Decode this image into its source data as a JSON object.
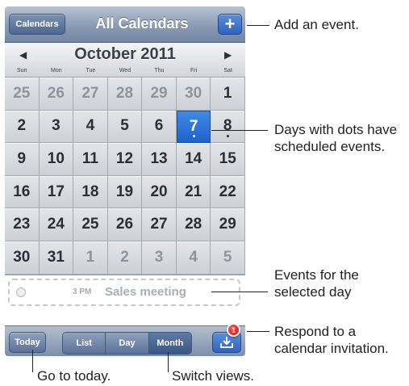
{
  "navbar": {
    "calendars_label": "Calendars",
    "title": "All Calendars",
    "add_label": "+"
  },
  "month": {
    "title": "October 2011",
    "prev_label": "◀",
    "next_label": "▶"
  },
  "weekdays": [
    "Sun",
    "Mon",
    "Tue",
    "Wed",
    "Thu",
    "Fri",
    "Sat"
  ],
  "days": [
    {
      "d": "25",
      "dim": true
    },
    {
      "d": "26",
      "dim": true
    },
    {
      "d": "27",
      "dim": true
    },
    {
      "d": "28",
      "dim": true
    },
    {
      "d": "29",
      "dim": true
    },
    {
      "d": "30",
      "dim": true
    },
    {
      "d": "1"
    },
    {
      "d": "2"
    },
    {
      "d": "3"
    },
    {
      "d": "4"
    },
    {
      "d": "5"
    },
    {
      "d": "6"
    },
    {
      "d": "7",
      "selected": true,
      "dot": true
    },
    {
      "d": "8",
      "dot": true
    },
    {
      "d": "9"
    },
    {
      "d": "10"
    },
    {
      "d": "11"
    },
    {
      "d": "12"
    },
    {
      "d": "13"
    },
    {
      "d": "14"
    },
    {
      "d": "15"
    },
    {
      "d": "16"
    },
    {
      "d": "17"
    },
    {
      "d": "18"
    },
    {
      "d": "19"
    },
    {
      "d": "20"
    },
    {
      "d": "21"
    },
    {
      "d": "22"
    },
    {
      "d": "23"
    },
    {
      "d": "24"
    },
    {
      "d": "25"
    },
    {
      "d": "26"
    },
    {
      "d": "27"
    },
    {
      "d": "28"
    },
    {
      "d": "29"
    },
    {
      "d": "30"
    },
    {
      "d": "31"
    },
    {
      "d": "1",
      "dim": true
    },
    {
      "d": "2",
      "dim": true
    },
    {
      "d": "3",
      "dim": true
    },
    {
      "d": "4",
      "dim": true
    },
    {
      "d": "5",
      "dim": true
    }
  ],
  "event": {
    "time": "3 PM",
    "title": "Sales meeting"
  },
  "toolbar": {
    "today_label": "Today",
    "views": [
      {
        "label": "List"
      },
      {
        "label": "Day"
      },
      {
        "label": "Month",
        "active": true
      }
    ],
    "badge_count": "1"
  },
  "callouts": {
    "add_event": "Add an event.",
    "dots": "Days with dots have scheduled events.",
    "events_for_day": "Events for the selected day",
    "invitation": "Respond to a calendar invitation.",
    "go_today": "Go to today.",
    "switch_views": "Switch views."
  },
  "colors": {
    "selected_day": "#2f74d8",
    "navbar": "#8a9bb3",
    "badge": "#d81e1e"
  },
  "icons": [
    "plus-icon",
    "left-arrow-icon",
    "right-arrow-icon",
    "inbox-download-icon"
  ]
}
